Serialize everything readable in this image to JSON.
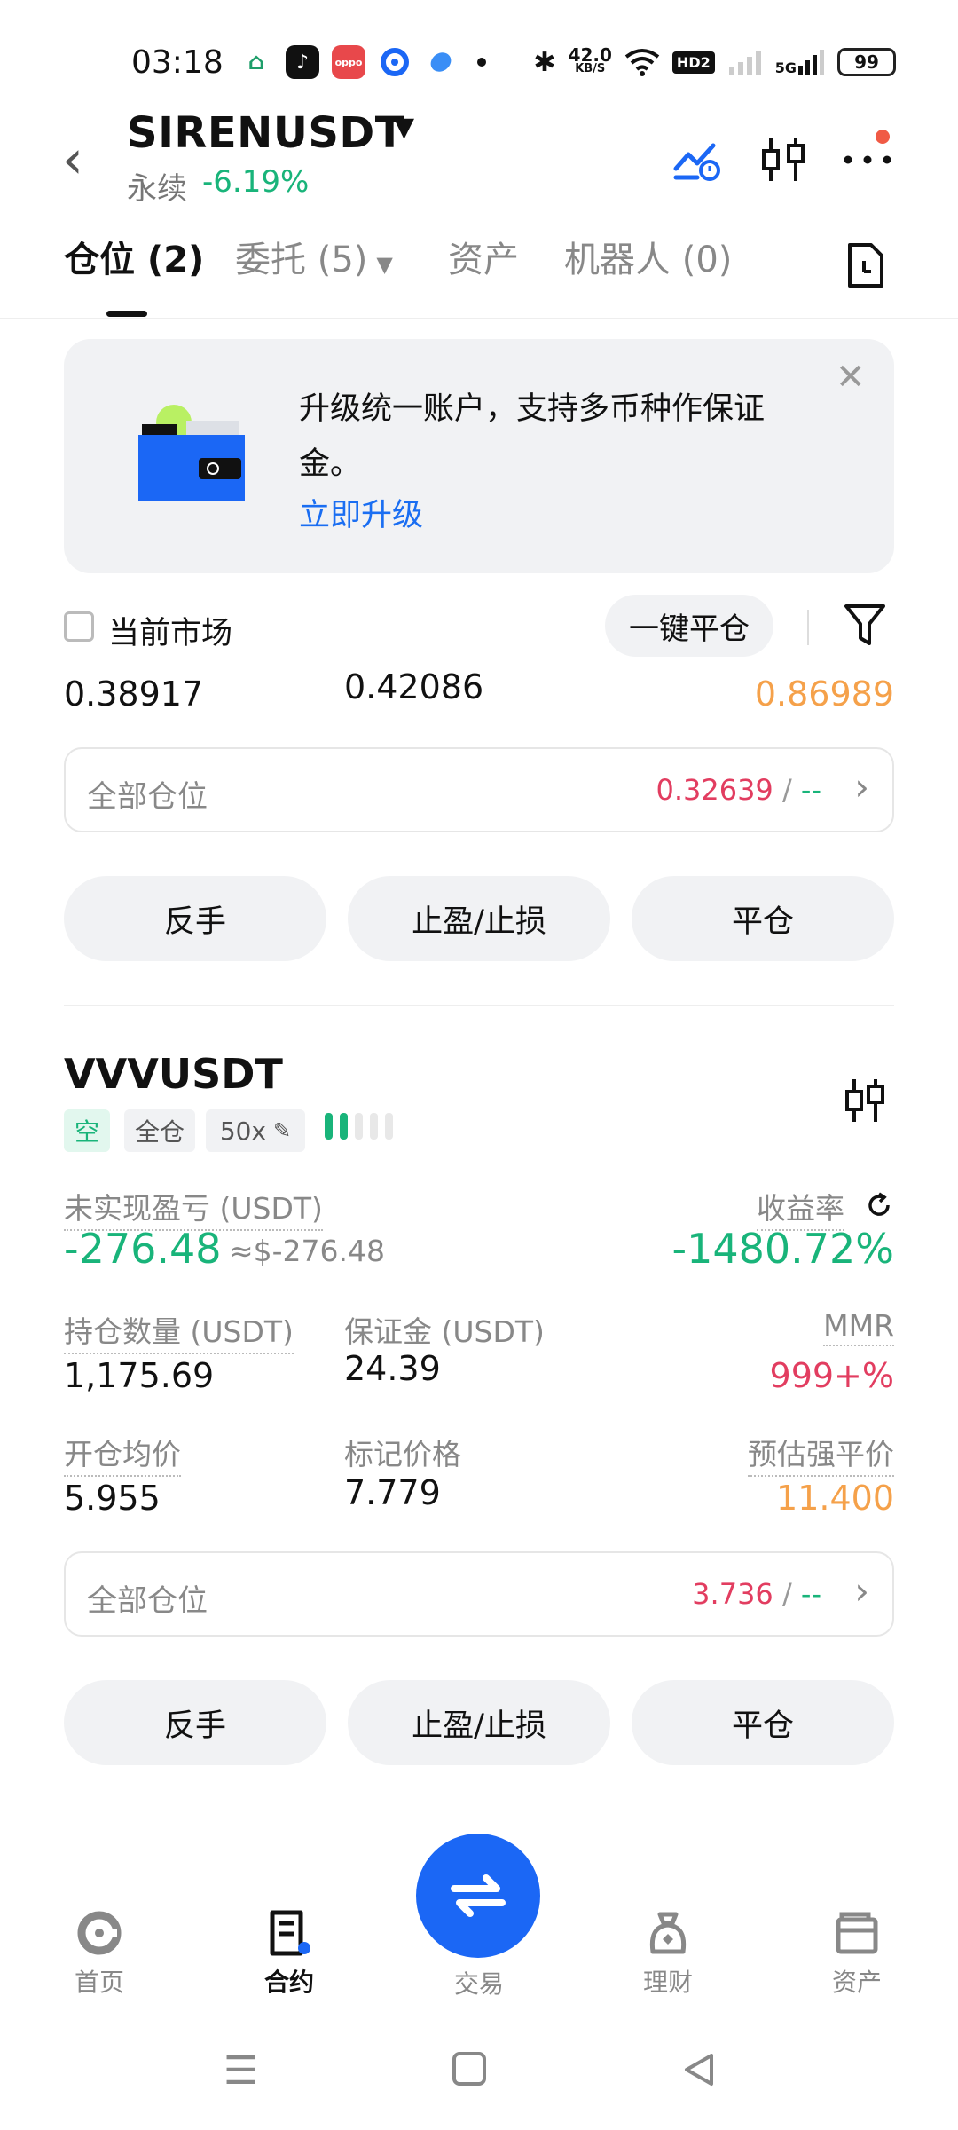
{
  "status_bar": {
    "time": "03:18",
    "net_speed_top": "42.0",
    "net_speed_unit": "KB/S",
    "hd_badge": "HD2",
    "signal_label": "5G",
    "battery": "99"
  },
  "header": {
    "pair": "SIRENUSDT",
    "type": "永续",
    "change": "-6.19%"
  },
  "tabs": [
    {
      "label": "仓位 (2)"
    },
    {
      "label": "委托 (5)"
    },
    {
      "label": "资产"
    },
    {
      "label": "机器人 (0)"
    }
  ],
  "banner": {
    "text": "升级统一账户，支持多币种作保证金。",
    "link": "立即升级"
  },
  "filter": {
    "current_market": "当前市场",
    "close_all": "一键平仓"
  },
  "first_position_partial": {
    "values": [
      "0.38917",
      "0.42086",
      "0.86989"
    ],
    "all_positions_label": "全部仓位",
    "all_positions_value": "0.32639",
    "all_positions_sep": " / ",
    "all_positions_dash": "--",
    "buttons": [
      "反手",
      "止盈/止损",
      "平仓"
    ]
  },
  "position": {
    "symbol": "VVVUSDT",
    "tag_side": "空",
    "tag_margin": "全仓",
    "tag_leverage": "50x",
    "leverage_level": 2,
    "unrealized_label": "未实现盈亏 (USDT)",
    "unrealized_value": "-276.48",
    "unrealized_usd": "≈$-276.48",
    "roe_label": "收益率",
    "roe_value": "-1480.72%",
    "size_label": "持仓数量 (USDT)",
    "size_value": "1,175.69",
    "margin_label": "保证金 (USDT)",
    "margin_value": "24.39",
    "mmr_label": "MMR",
    "mmr_value": "999+%",
    "entry_label": "开仓均价",
    "entry_value": "5.955",
    "mark_label": "标记价格",
    "mark_value": "7.779",
    "liq_label": "预估强平价",
    "liq_value": "11.400",
    "all_positions_label": "全部仓位",
    "all_positions_value": "3.736",
    "all_positions_sep": " / ",
    "all_positions_dash": "--",
    "buttons": [
      "反手",
      "止盈/止损",
      "平仓"
    ]
  },
  "bottom_nav": [
    {
      "label": "首页"
    },
    {
      "label": "合约"
    },
    {
      "label": "交易"
    },
    {
      "label": "理财"
    },
    {
      "label": "资产"
    }
  ],
  "colors": {
    "green": "#19b47a",
    "red": "#e23d60",
    "orange": "#f5a14a",
    "blue": "#1b67f5"
  }
}
